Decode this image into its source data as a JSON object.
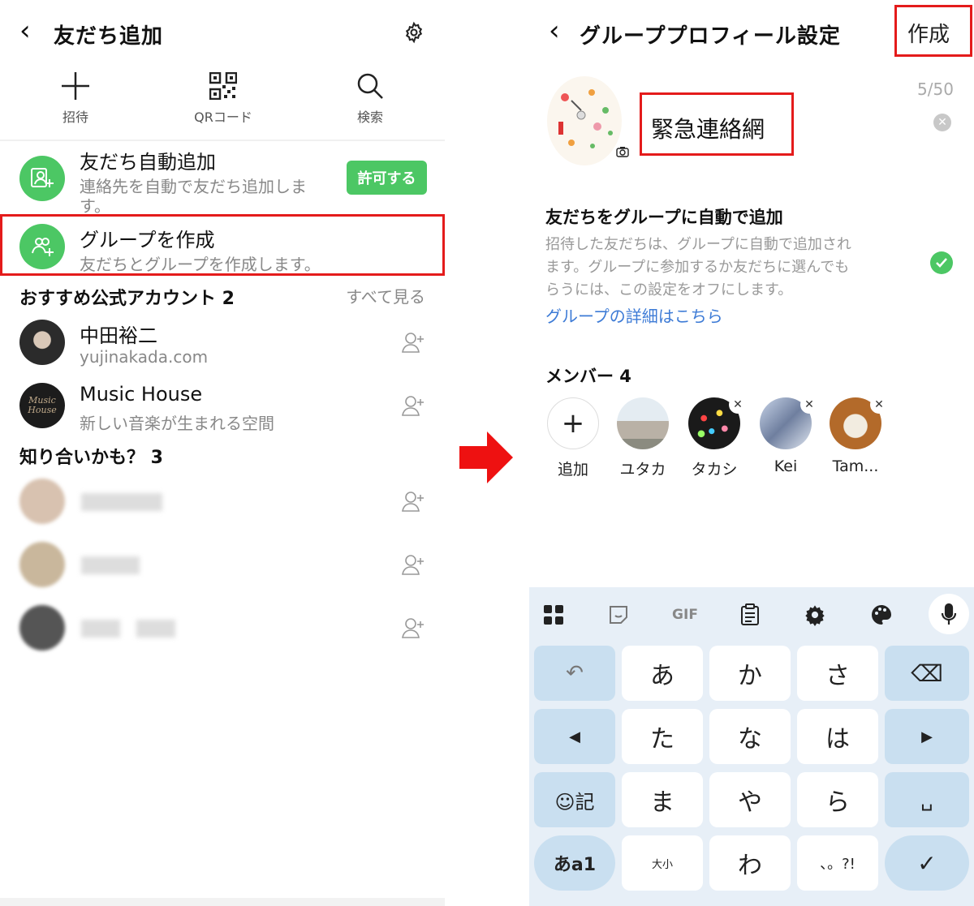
{
  "left": {
    "title": "友だち追加",
    "tools": [
      {
        "label": "招待",
        "icon": "plus-icon"
      },
      {
        "label": "QRコード",
        "icon": "qr-code-icon"
      },
      {
        "label": "検索",
        "icon": "search-icon"
      }
    ],
    "auto_add": {
      "title": "友だち自動追加",
      "subtitle": "連絡先を自動で友だち追加しま",
      "subtitle2": "す。",
      "button": "許可する"
    },
    "create_group": {
      "title": "グループを作成",
      "subtitle": "友だちとグループを作成します。"
    },
    "official": {
      "header": "おすすめ公式アカウント 2",
      "see_all": "すべて見る",
      "items": [
        {
          "name": "中田裕二",
          "sub": "yujinakada.com"
        },
        {
          "name": "Music House",
          "sub": "新しい音楽が生まれる空間",
          "avatar_text": "Music House"
        }
      ]
    },
    "maybe": {
      "header": "知り合いかも？ 3"
    }
  },
  "right": {
    "title": "グループプロフィール設定",
    "create_button": "作成",
    "counter": "5/50",
    "group_name": "緊急連絡網",
    "auto_add": {
      "title": "友だちをグループに自動で追加",
      "desc1": "招待した友だちは、グループに自動で追加され",
      "desc2": "ます。グループに参加するか友だちに選んでも",
      "desc3": "らうには、この設定をオフにします。",
      "link": "グループの詳細はこちら"
    },
    "members": {
      "header": "メンバー 4",
      "items": [
        {
          "name": "追加"
        },
        {
          "name": "ユタカ"
        },
        {
          "name": "タカシ"
        },
        {
          "name": "Kei"
        },
        {
          "name": "Tam..."
        }
      ]
    },
    "keyboard": {
      "toolbar_gif": "GIF",
      "rows": [
        [
          "↶",
          "あ",
          "か",
          "さ",
          "⌫"
        ],
        [
          "◀",
          "た",
          "な",
          "は",
          "▶"
        ],
        [
          "☺記",
          "ま",
          "や",
          "ら",
          "␣"
        ],
        [
          "あa1",
          "大小",
          "わ",
          "、。?!",
          "✓"
        ]
      ]
    }
  },
  "colors": {
    "green": "#4cc764",
    "red": "#e41b1b",
    "link": "#3d7bd6",
    "keyboard_bg": "#e7eff7",
    "function_key": "#c9dff0"
  }
}
